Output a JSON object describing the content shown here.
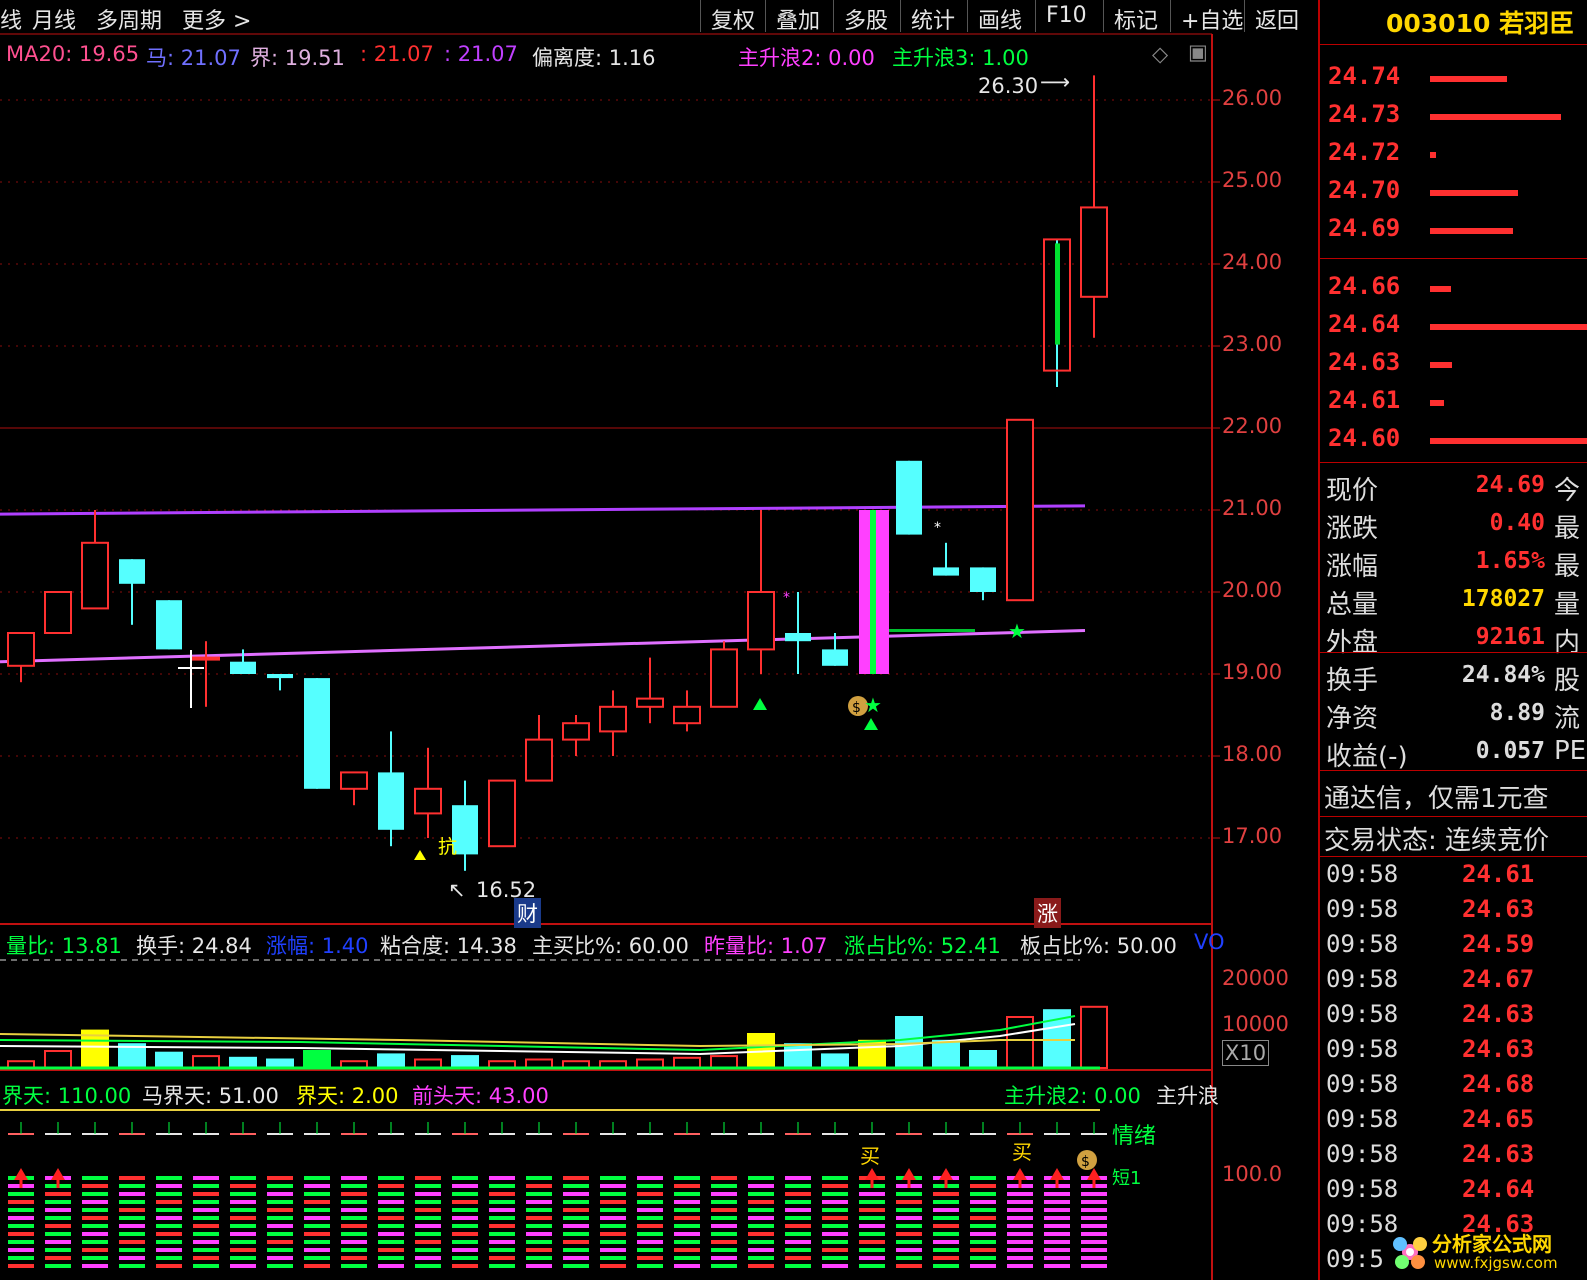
{
  "toolbar": {
    "left_items": [
      "线",
      "月线",
      "多周期",
      "更多 >"
    ],
    "buttons": [
      "复权",
      "叠加",
      "多股",
      "统计",
      "画线",
      "F10",
      "标记",
      "+自选",
      "返回"
    ]
  },
  "indicator_header": {
    "ma20_label": "MA20: 19.65",
    "ma_label": "马: 21.07",
    "jie_label": "界: 19.51",
    "v1_label": ": 21.07",
    "v2_label": ": 21.07",
    "deviation_label": "偏离度: 1.16",
    "wave2_label": "主升浪2: 0.00",
    "wave3_label": "主升浪3: 1.00"
  },
  "price_axis": {
    "ticks": [
      "26.00",
      "25.00",
      "24.00",
      "23.00",
      "22.00",
      "21.00",
      "20.00",
      "19.00",
      "18.00",
      "17.00"
    ],
    "values": [
      26,
      25,
      24,
      23,
      22,
      21,
      20,
      19,
      18,
      17
    ]
  },
  "annotations": {
    "high_label": "26.30",
    "low_label": "16.52",
    "cai_badge": "财",
    "zhang_badge": "涨",
    "kang_text": "抗"
  },
  "volume_header": {
    "liangbi": "量比: 13.81",
    "huanshou": "换手: 24.84",
    "zhangfu": "涨幅: 1.40",
    "nianhe": "粘合度: 14.38",
    "zhumai": "主买比%: 60.00",
    "zuoliang": "昨量比: 1.07",
    "zhangzhan": "涨占比%: 52.41",
    "banzhan": "板占比%: 50.00",
    "vol_tag": "VO"
  },
  "volume_axis": {
    "ticks": [
      "20000",
      "10000"
    ],
    "unit": "X10"
  },
  "bottom_header": {
    "jietian": "界天: 110.00",
    "majietian": "马界天: 51.00",
    "jietian2": "界天: 2.00",
    "qiantou": "前头天: 43.00",
    "wave2": "主升浪2: 0.00",
    "wave_more": "主升浪"
  },
  "bottom_axis": {
    "tick": "100.0"
  },
  "bottom_labels": {
    "qingxu": "情绪",
    "buy1": "买",
    "buy2": "买",
    "duan": "短1"
  },
  "side": {
    "title": "003010 若羽臣",
    "orderbook": [
      {
        "price": "24.74",
        "bar": 0.48
      },
      {
        "price": "24.73",
        "bar": 0.82
      },
      {
        "price": "24.72",
        "bar": 0.04
      },
      {
        "price": "24.70",
        "bar": 0.55
      },
      {
        "price": "24.69",
        "bar": 0.52
      },
      {
        "price": "24.66",
        "bar": 0.13
      },
      {
        "price": "24.64",
        "bar": 1.0
      },
      {
        "price": "24.63",
        "bar": 0.14
      },
      {
        "price": "24.61",
        "bar": 0.09
      },
      {
        "price": "24.60",
        "bar": 1.0
      }
    ],
    "quote": [
      {
        "label": "现价",
        "value": "24.69",
        "extra": "今",
        "color": "#ff3030"
      },
      {
        "label": "涨跌",
        "value": "0.40",
        "extra": "最",
        "color": "#ff3030"
      },
      {
        "label": "涨幅",
        "value": "1.65%",
        "extra": "最",
        "color": "#ff3030"
      },
      {
        "label": "总量",
        "value": "178027",
        "extra": "量",
        "color": "#ffd700"
      },
      {
        "label": "外盘",
        "value": "92161",
        "extra": "内",
        "color": "#ff3030"
      },
      {
        "label": "换手",
        "value": "24.84%",
        "extra": "股",
        "color": "#dddddd"
      },
      {
        "label": "净资",
        "value": "8.89",
        "extra": "流",
        "color": "#dddddd"
      },
      {
        "label": "收益(-)",
        "value": "0.057",
        "extra": "PE",
        "color": "#dddddd"
      }
    ],
    "notice1": "通达信，仅需1元查",
    "notice2": "交易状态: 连续竞价",
    "ticks": [
      {
        "time": "09:58",
        "price": "24.61"
      },
      {
        "time": "09:58",
        "price": "24.63"
      },
      {
        "time": "09:58",
        "price": "24.59"
      },
      {
        "time": "09:58",
        "price": "24.67"
      },
      {
        "time": "09:58",
        "price": "24.63"
      },
      {
        "time": "09:58",
        "price": "24.63"
      },
      {
        "time": "09:58",
        "price": "24.68"
      },
      {
        "time": "09:58",
        "price": "24.65"
      },
      {
        "time": "09:58",
        "price": "24.63"
      },
      {
        "time": "09:58",
        "price": "24.64"
      },
      {
        "time": "09:58",
        "price": "24.63"
      },
      {
        "time": "09:5",
        "price": ""
      }
    ],
    "watermark_cn": "分析家公式网",
    "watermark_url": "www.fxjgsw.com"
  },
  "colors": {
    "up": "#ff3030",
    "down": "#55ffff",
    "ma_purple": "#b040ff",
    "ma_pink": "#e070ff",
    "grid_red": "#c01010",
    "yellow": "#ffff00",
    "green": "#00ff40"
  },
  "chart_data": {
    "type": "candlestick",
    "candles": [
      {
        "o": 19.1,
        "h": 19.5,
        "l": 18.9,
        "c": 19.5
      },
      {
        "o": 19.5,
        "h": 20.0,
        "l": 19.5,
        "c": 20.0
      },
      {
        "o": 19.8,
        "h": 21.0,
        "l": 19.8,
        "c": 20.6
      },
      {
        "o": 20.4,
        "h": 20.4,
        "l": 19.6,
        "c": 20.1
      },
      {
        "o": 19.9,
        "h": 19.9,
        "l": 19.3,
        "c": 19.3
      },
      {
        "o": 19.2,
        "h": 19.4,
        "l": 18.6,
        "c": 19.2
      },
      {
        "o": 19.15,
        "h": 19.3,
        "l": 19.0,
        "c": 19.0
      },
      {
        "o": 19.0,
        "h": 19.0,
        "l": 18.8,
        "c": 18.95
      },
      {
        "o": 18.95,
        "h": 18.95,
        "l": 17.6,
        "c": 17.6
      },
      {
        "o": 17.6,
        "h": 17.8,
        "l": 17.4,
        "c": 17.8
      },
      {
        "o": 17.8,
        "h": 18.3,
        "l": 16.9,
        "c": 17.1
      },
      {
        "o": 17.3,
        "h": 18.1,
        "l": 17.0,
        "c": 17.6
      },
      {
        "o": 17.4,
        "h": 17.7,
        "l": 16.6,
        "c": 16.8
      },
      {
        "o": 16.9,
        "h": 17.7,
        "l": 16.9,
        "c": 17.7
      },
      {
        "o": 17.7,
        "h": 18.5,
        "l": 17.7,
        "c": 18.2
      },
      {
        "o": 18.2,
        "h": 18.5,
        "l": 18.0,
        "c": 18.4
      },
      {
        "o": 18.3,
        "h": 18.8,
        "l": 18.0,
        "c": 18.6
      },
      {
        "o": 18.6,
        "h": 19.2,
        "l": 18.4,
        "c": 18.7
      },
      {
        "o": 18.4,
        "h": 18.8,
        "l": 18.3,
        "c": 18.6
      },
      {
        "o": 18.6,
        "h": 19.4,
        "l": 18.6,
        "c": 19.3
      },
      {
        "o": 19.3,
        "h": 21.0,
        "l": 19.0,
        "c": 20.0
      },
      {
        "o": 19.5,
        "h": 20.0,
        "l": 19.0,
        "c": 19.4
      },
      {
        "o": 19.3,
        "h": 19.5,
        "l": 19.1,
        "c": 19.1
      },
      {
        "o": 19.0,
        "h": 21.0,
        "l": 19.0,
        "c": 21.0
      },
      {
        "o": 21.6,
        "h": 21.6,
        "l": 20.7,
        "c": 20.7
      },
      {
        "o": 20.3,
        "h": 20.6,
        "l": 20.2,
        "c": 20.2
      },
      {
        "o": 20.3,
        "h": 20.3,
        "l": 19.9,
        "c": 20.0
      },
      {
        "o": 19.9,
        "h": 22.1,
        "l": 19.9,
        "c": 22.1
      },
      {
        "o": 24.3,
        "h": 24.3,
        "l": 22.5,
        "c": 22.7
      },
      {
        "o": 23.6,
        "h": 26.3,
        "l": 23.1,
        "c": 24.69
      }
    ],
    "volumes": [
      0.2,
      0.5,
      1.1,
      0.7,
      0.45,
      0.35,
      0.3,
      0.25,
      0.5,
      0.2,
      0.4,
      0.25,
      0.35,
      0.2,
      0.25,
      0.2,
      0.2,
      0.25,
      0.3,
      0.35,
      1.0,
      0.7,
      0.4,
      0.8,
      1.5,
      0.8,
      0.5,
      1.5,
      1.7,
      1.8
    ],
    "ylim": [
      16.3,
      26.6
    ]
  }
}
